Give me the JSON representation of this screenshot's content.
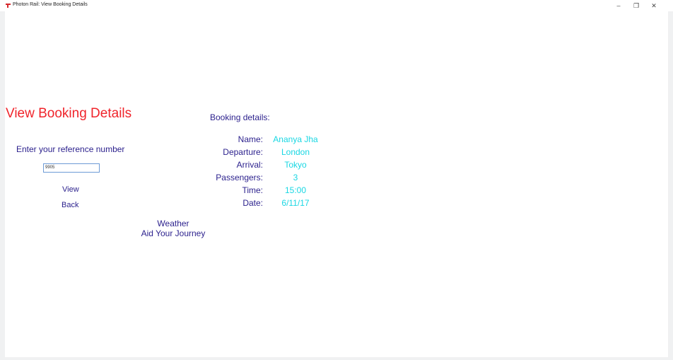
{
  "window": {
    "title": "Photon Rail: View Booking Details",
    "controls": {
      "minimize": "–",
      "maximize": "❐",
      "close": "✕"
    }
  },
  "left": {
    "heading": "View Booking Details",
    "ref_label": "Enter your reference number",
    "ref_value": "9905",
    "view_label": "View",
    "back_label": "Back",
    "weather_line1": "Weather",
    "weather_line2": "Aid Your Journey"
  },
  "details": {
    "title": "Booking details:",
    "rows": [
      {
        "label": "Name:",
        "value": "Ananya Jha"
      },
      {
        "label": "Departure:",
        "value": "London"
      },
      {
        "label": "Arrival:",
        "value": "Tokyo"
      },
      {
        "label": "Passengers:",
        "value": "3"
      },
      {
        "label": "Time:",
        "value": "15:00"
      },
      {
        "label": "Date:",
        "value": "6/11/17"
      }
    ]
  },
  "colors": {
    "heading": "#f0242b",
    "text": "#2a1f8c",
    "value": "#19d7e3",
    "input_border": "#6d9bd6"
  },
  "icons": {
    "app": "photon-rail-app-icon"
  }
}
